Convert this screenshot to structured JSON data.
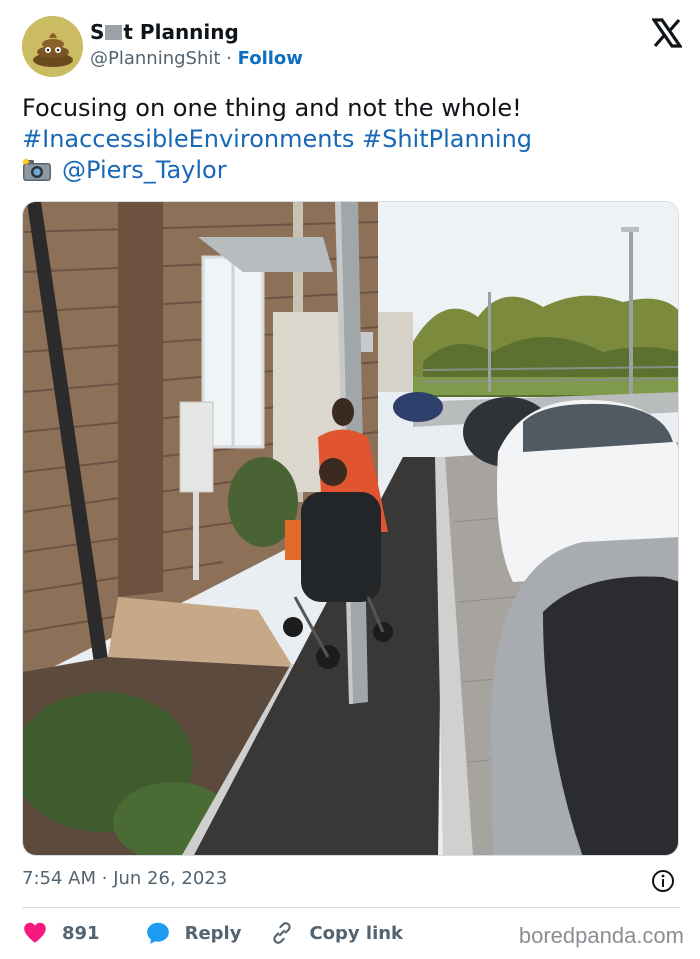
{
  "author": {
    "name_start": "S",
    "name_end": "t Planning",
    "handle": "@PlanningShit",
    "separator": "·",
    "follow_label": "Follow"
  },
  "tweet": {
    "line1": "Focusing on one thing and not the whole!",
    "hashtag1": "#InaccessibleEnvironments",
    "hashtag2": "#ShitPlanning",
    "mention": "@Piers_Taylor"
  },
  "meta": {
    "time": "7:54 AM",
    "separator": "·",
    "date": "Jun 26, 2023"
  },
  "actions": {
    "likes": "891",
    "reply_label": "Reply",
    "copy_label": "Copy link"
  },
  "watermark": "boredpanda.com",
  "icons": [
    "avatar-poop-icon",
    "x-logo-icon",
    "camera-icon",
    "info-icon",
    "heart-icon",
    "reply-bubble-icon",
    "link-icon"
  ],
  "colors": {
    "link": "#1868b7",
    "follow": "#0d6fbf",
    "heart": "#f91880",
    "reply_icon": "#1d9bf0",
    "secondary_text": "#536471"
  }
}
